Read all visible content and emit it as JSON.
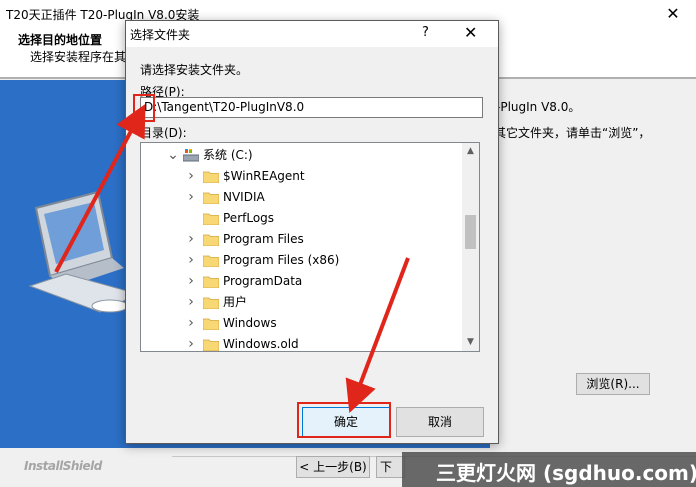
{
  "installer": {
    "title": "T20天正插件 T20-PlugIn V8.0安装",
    "close_glyph": "✕",
    "header_title": "选择目的地位置",
    "header_subtitle": "选择安装程序在其",
    "info_line1": "-PlugIn V8.0。",
    "info_line2": "其它文件夹，请单击“浏览”，",
    "browse_label": "浏览(R)...",
    "logo_text": "InstallShield",
    "back_label": "< 上一步(B)",
    "next_label": "下"
  },
  "watermark": {
    "text": "三更灯火网 (sgdhuo.com)"
  },
  "dialog": {
    "title": "选择文件夹",
    "help_glyph": "?",
    "close_glyph": "✕",
    "prompt": "请选择安装文件夹。",
    "path_label": "路径(P):",
    "path_value": "D:\\Tangent\\T20-PlugInV8.0",
    "dir_label": "目录(D):",
    "tree": [
      {
        "label": "系统 (C:)",
        "chevron": "v",
        "icon": "drive-icon"
      },
      {
        "label": "$WinREAgent",
        "chevron": ">",
        "icon": "folder-icon"
      },
      {
        "label": "NVIDIA",
        "chevron": ">",
        "icon": "folder-icon"
      },
      {
        "label": "PerfLogs",
        "chevron": "",
        "icon": "folder-icon"
      },
      {
        "label": "Program Files",
        "chevron": ">",
        "icon": "folder-icon"
      },
      {
        "label": "Program Files (x86)",
        "chevron": ">",
        "icon": "folder-icon"
      },
      {
        "label": "ProgramData",
        "chevron": ">",
        "icon": "folder-icon"
      },
      {
        "label": "用户",
        "chevron": ">",
        "icon": "folder-icon"
      },
      {
        "label": "Windows",
        "chevron": ">",
        "icon": "folder-icon"
      },
      {
        "label": "Windows.old",
        "chevron": ">",
        "icon": "folder-icon"
      }
    ],
    "ok_label": "确定",
    "cancel_label": "取消"
  },
  "colors": {
    "accent_blue": "#2c6fc6",
    "highlight_red": "#e0251b",
    "folder_yellow": "#f8d775"
  }
}
